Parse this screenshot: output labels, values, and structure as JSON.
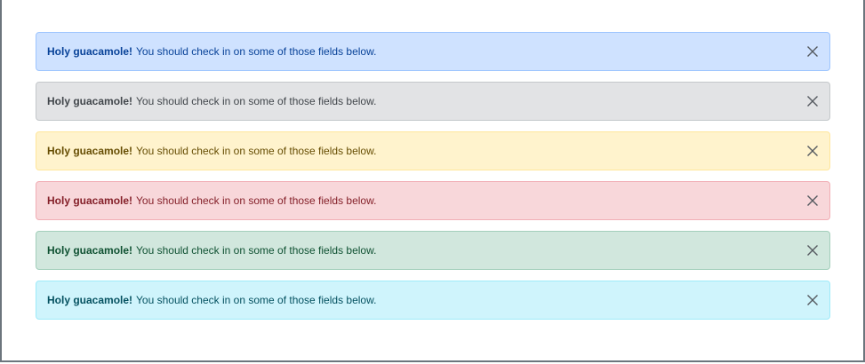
{
  "alerts": [
    {
      "variant": "primary",
      "heading": "Holy guacamole!",
      "message": "You should check in on some of those fields below.",
      "close_icon": "close-icon",
      "colors": {
        "bg": "#cfe2ff",
        "border": "#9ec5fe",
        "text": "#084298",
        "close": "#555a60"
      }
    },
    {
      "variant": "secondary",
      "heading": "Holy guacamole!",
      "message": "You should check in on some of those fields below.",
      "close_icon": "close-icon",
      "colors": {
        "bg": "#e2e3e5",
        "border": "#c4c8cb",
        "text": "#41464b",
        "close": "#555a60"
      }
    },
    {
      "variant": "warning",
      "heading": "Holy guacamole!",
      "message": "You should check in on some of those fields below.",
      "close_icon": "close-icon",
      "colors": {
        "bg": "#fff3cd",
        "border": "#ffe69c",
        "text": "#664d03",
        "close": "#555a60"
      }
    },
    {
      "variant": "danger",
      "heading": "Holy guacamole!",
      "message": "You should check in on some of those fields below.",
      "close_icon": "close-icon",
      "colors": {
        "bg": "#f8d7da",
        "border": "#f1aeb5",
        "text": "#842029",
        "close": "#555a60"
      }
    },
    {
      "variant": "success",
      "heading": "Holy guacamole!",
      "message": "You should check in on some of those fields below.",
      "close_icon": "close-icon",
      "colors": {
        "bg": "#d1e7dd",
        "border": "#a3cfbb",
        "text": "#0f5132",
        "close": "#555a60"
      }
    },
    {
      "variant": "info",
      "heading": "Holy guacamole!",
      "message": "You should check in on some of those fields below.",
      "close_icon": "close-icon",
      "colors": {
        "bg": "#cff4fc",
        "border": "#9eeaf9",
        "text": "#055160",
        "close": "#555a60"
      }
    }
  ]
}
